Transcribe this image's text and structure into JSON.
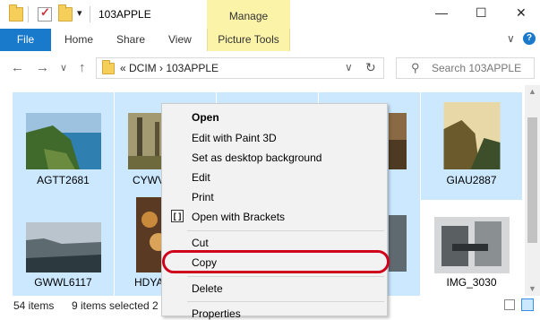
{
  "title_bar": {
    "window_title": "103APPLE",
    "context_tab_group": "Manage",
    "minimize": "—",
    "maximize": "☐",
    "close": "✕",
    "qa_dropdown": "▾"
  },
  "ribbon": {
    "tabs": [
      "File",
      "Home",
      "Share",
      "View"
    ],
    "context_tab": "Picture Tools",
    "collapse": "∨",
    "help": "?"
  },
  "nav": {
    "back": "←",
    "forward": "→",
    "recent": "∨",
    "up": "↑",
    "address_path": "«  DCIM  ›  103APPLE",
    "address_dropdown": "∨",
    "refresh": "↻",
    "search_placeholder": "Search 103APPLE"
  },
  "files": [
    {
      "name": "AGTT2681",
      "selected": true
    },
    {
      "name": "CYWV",
      "selected": true
    },
    {
      "name": "",
      "selected": true
    },
    {
      "name": "",
      "selected": true
    },
    {
      "name": "GIAU2887",
      "selected": true
    },
    {
      "name": "GWWL6117",
      "selected": true
    },
    {
      "name": "HDYA",
      "selected": true
    },
    {
      "name": "",
      "selected": true
    },
    {
      "name": "",
      "selected": true
    },
    {
      "name": "IMG_3030",
      "selected": false
    }
  ],
  "context_menu": {
    "items": [
      "Open",
      "Edit with Paint 3D",
      "Set as desktop background",
      "Edit",
      "Print",
      "Open with Brackets",
      "Cut",
      "Copy",
      "Delete",
      "Properties"
    ],
    "brackets_icon": "[ ]"
  },
  "status_bar": {
    "item_count": "54 items",
    "selection": "9 items selected  2"
  },
  "colors": {
    "accent": "#1979ca",
    "selection": "#cce8ff",
    "manage_tab": "#fbf3a7",
    "highlight_oval": "#d0021b"
  }
}
